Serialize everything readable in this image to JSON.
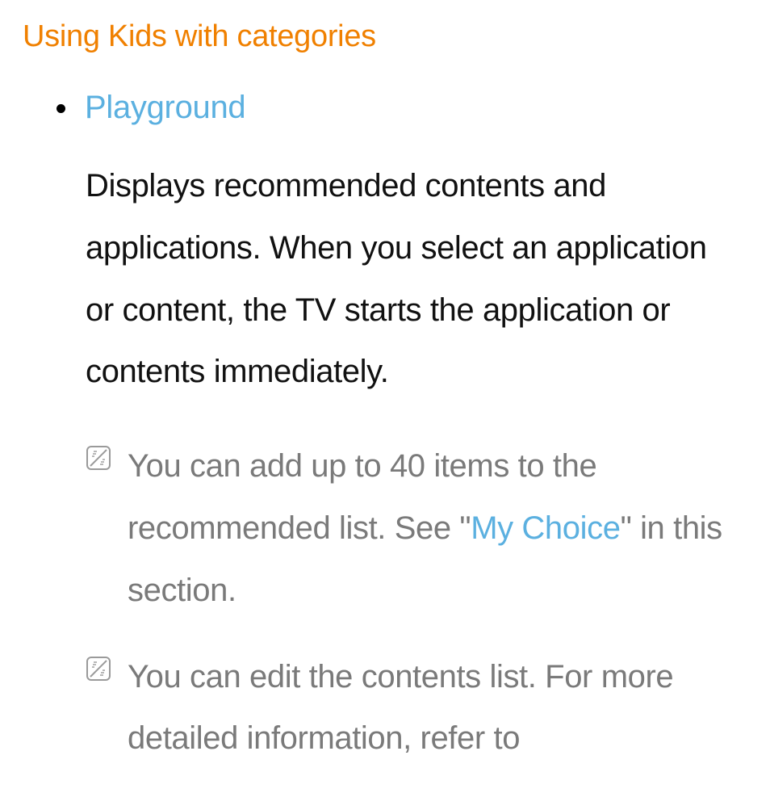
{
  "heading": "Using Kids with categories",
  "bullet": {
    "title": "Playground",
    "body": "Displays recommended contents and applications. When you select an application or content, the TV starts the application or contents immediately."
  },
  "notes": [
    {
      "pre": "You can add up to 40 items to the recommended list. See \"",
      "link": "My Choice",
      "post": "\" in this section."
    },
    {
      "pre": "You can edit the contents list. For more detailed information, refer to",
      "link": "",
      "post": ""
    }
  ]
}
